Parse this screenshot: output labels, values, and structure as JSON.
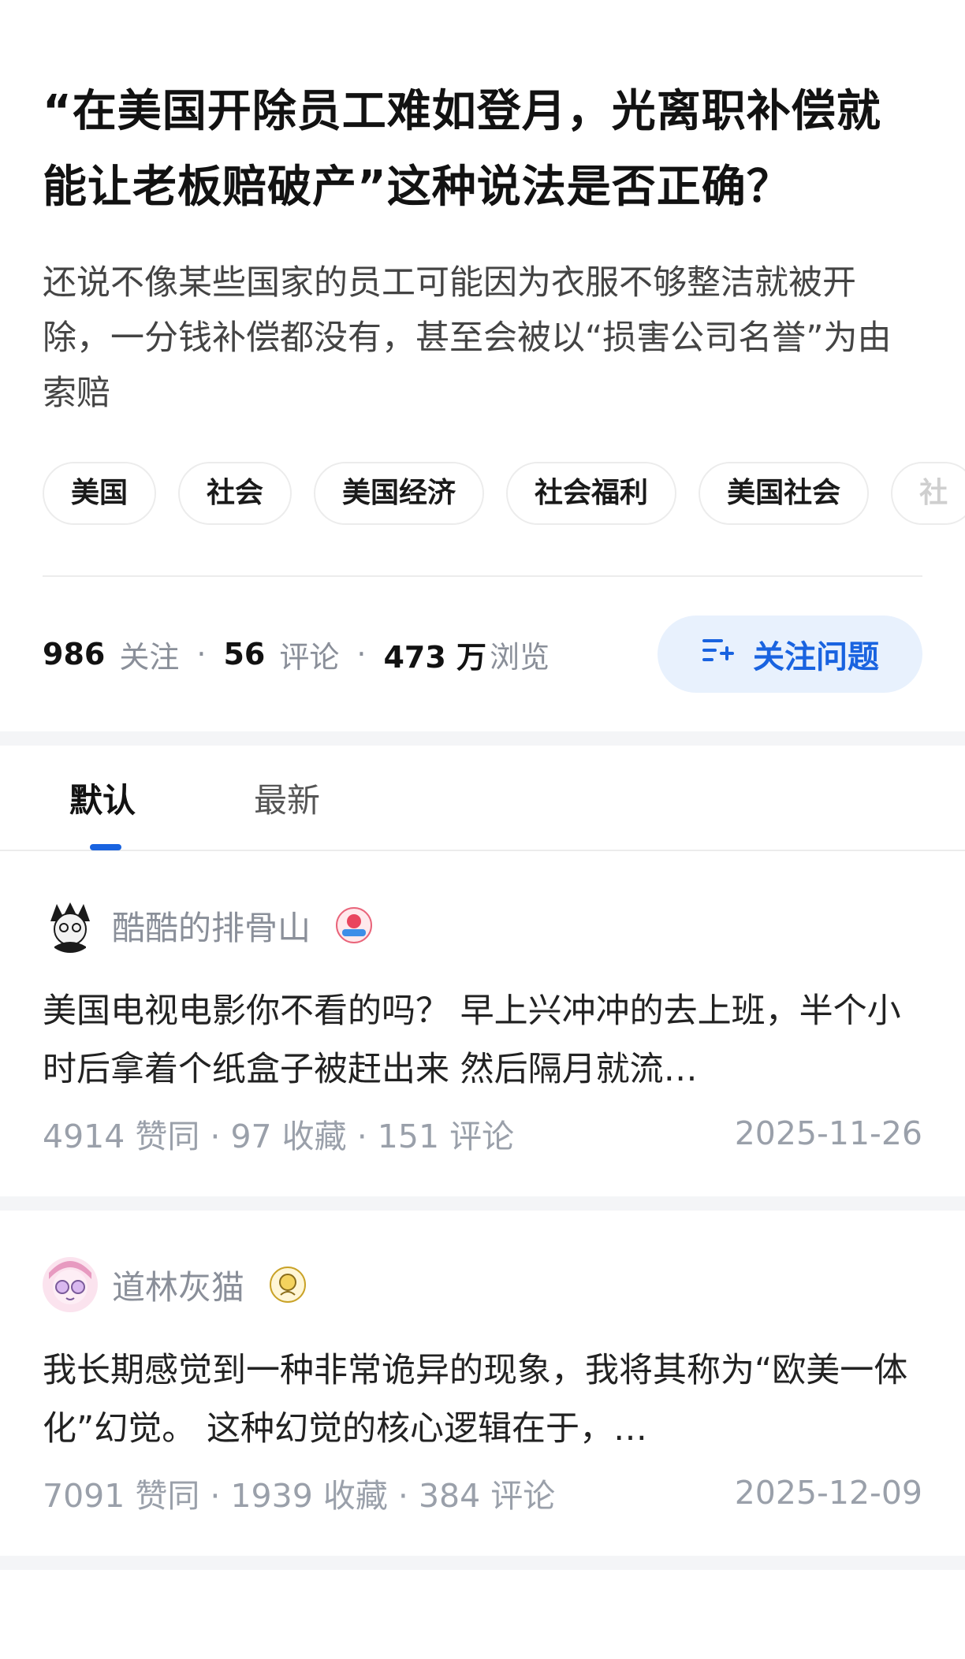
{
  "question": {
    "title": "“在美国开除员工难如登月，光离职补偿就能让老板赔破产”这种说法是否正确？",
    "description": "还说不像某些国家的员工可能因为衣服不够整洁就被开除，一分钱补偿都没有，甚至会被以“损害公司名誉”为由索赔",
    "tags": [
      "美国",
      "社会",
      "美国经济",
      "社会福利",
      "美国社会",
      "社"
    ],
    "stats": {
      "followers_num": "986",
      "followers_label": "关注",
      "comments_num": "56",
      "comments_label": "评论",
      "views_num": "473 万",
      "views_label": "浏览",
      "separator": "·"
    },
    "follow_button_label": "关注问题"
  },
  "tabs": [
    {
      "label": "默认",
      "active": true
    },
    {
      "label": "最新",
      "active": false
    }
  ],
  "answers": [
    {
      "author": "酷酷的排骨山",
      "excerpt": "美国电视电影你不看的吗？ 早上兴冲冲的去上班，半个小时后拿着个纸盒子被赶出来 然后隔月就流…",
      "stats": "4914 赞同 · 97 收藏 · 151 评论",
      "date": "2025-11-26"
    },
    {
      "author": "道林灰猫",
      "excerpt": "我长期感觉到一种非常诡异的现象，我将其称为“欧美一体化”幻觉。 这种幻觉的核心逻辑在于，…",
      "stats": "7091 赞同 · 1939 收藏 · 384 评论",
      "date": "2025-12-09"
    }
  ],
  "colors": {
    "accent": "#1963e0",
    "follow_button_bg": "#e8f1fd",
    "meta_gray": "#9aa0aa"
  },
  "icons": {
    "follow": "add-list-icon"
  }
}
